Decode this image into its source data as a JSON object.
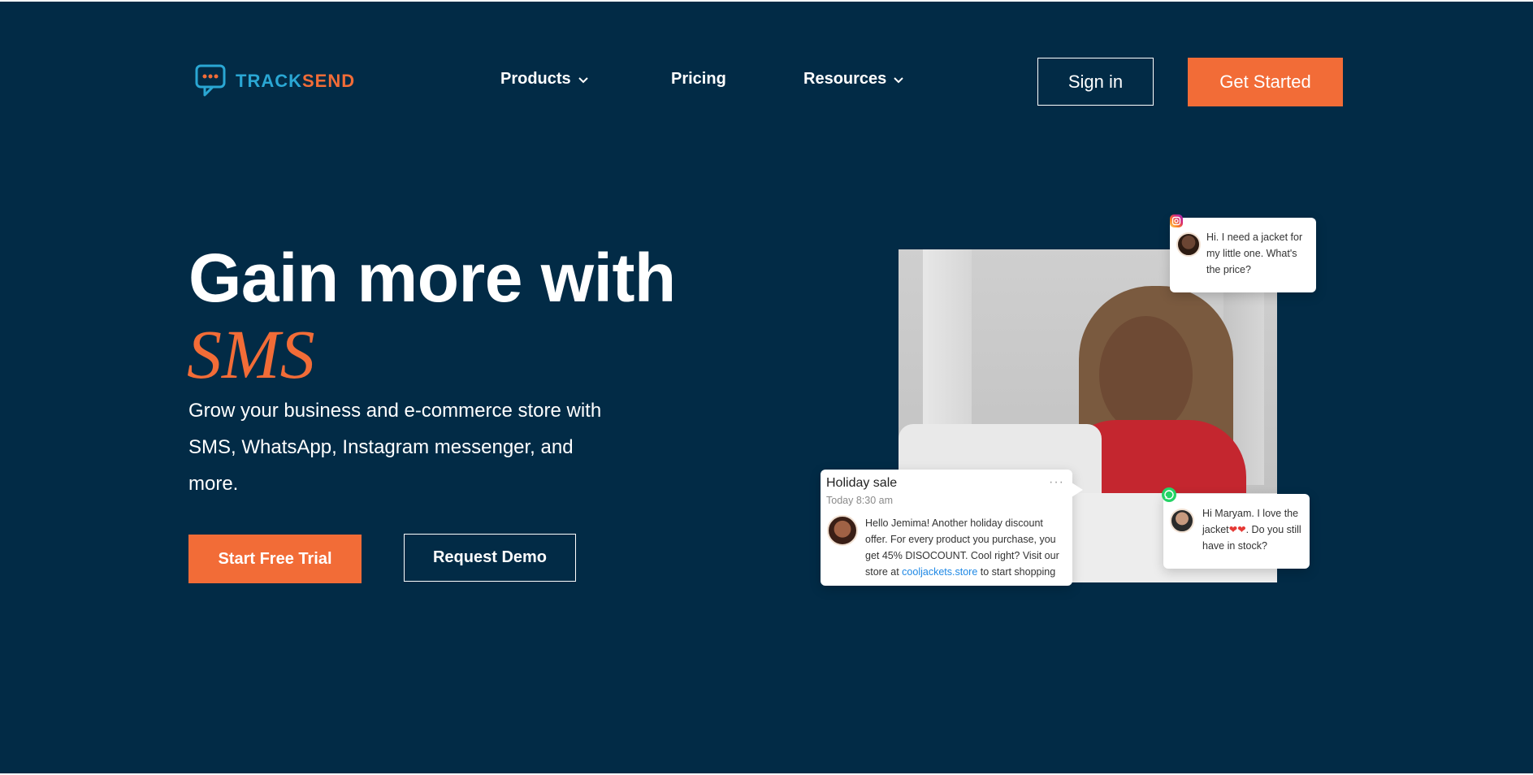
{
  "header": {
    "logo": {
      "part1": "TRACK",
      "part2": "SEND"
    },
    "nav": [
      {
        "label": "Products",
        "has_dropdown": true
      },
      {
        "label": "Pricing",
        "has_dropdown": false
      },
      {
        "label": "Resources",
        "has_dropdown": true
      }
    ],
    "signin_label": "Sign in",
    "getstarted_label": "Get Started"
  },
  "hero": {
    "title_line1": "Gain more with",
    "title_highlight": "SMS",
    "subtitle": "Grow your business and e-commerce store with SMS, WhatsApp, Instagram messenger, and more.",
    "primary_button": "Start Free Trial",
    "secondary_button": "Request Demo"
  },
  "chat_cards": {
    "instagram": {
      "message": "Hi. I need a jacket for my little one. What's the price?"
    },
    "whatsapp": {
      "message_before": "Hi Maryam. I love the jacket",
      "hearts": "❤❤",
      "message_after": ". Do you still have in stock?"
    },
    "holiday": {
      "title": "Holiday sale",
      "time": "Today 8:30 am",
      "menu": "···",
      "body_before": "Hello Jemima! Another holiday discount offer. For every product you purchase, you get 45% DISOCOUNT. Cool right? Visit our store at ",
      "link": "cooljackets.store",
      "body_after": " to start shopping"
    }
  },
  "colors": {
    "background": "#022b46",
    "accent": "#f26c37",
    "logo_blue": "#2aa7d4",
    "link": "#1e88e5"
  },
  "icons": {
    "logo": "chat-bubble-icon",
    "dropdown": "chevron-down-icon",
    "instagram": "instagram-icon",
    "whatsapp": "whatsapp-icon"
  }
}
